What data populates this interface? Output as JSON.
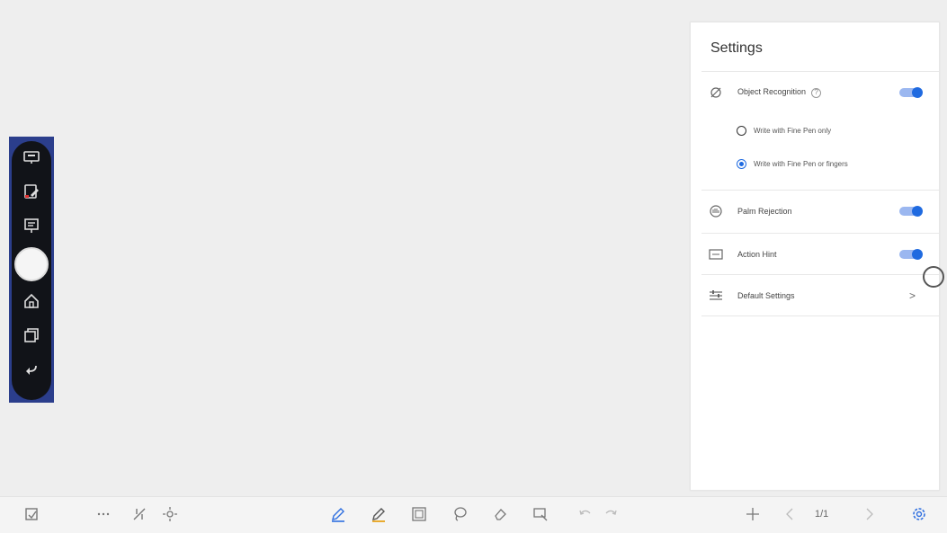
{
  "settings": {
    "title": "Settings",
    "object_recognition": {
      "label": "Object Recognition",
      "enabled": true
    },
    "radio_options": [
      {
        "label": "Write with Fine Pen only",
        "selected": false
      },
      {
        "label": "Write with Fine Pen or fingers",
        "selected": true
      }
    ],
    "palm_rejection": {
      "label": "Palm Rejection",
      "enabled": true
    },
    "action_hint": {
      "label": "Action Hint",
      "enabled": true
    },
    "default_settings": {
      "label": "Default Settings",
      "chevron": ">"
    }
  },
  "bottom_bar": {
    "page_indicator": "1/1"
  },
  "icons": {
    "side": [
      "screen-icon",
      "annotate-icon",
      "whiteboard-icon",
      "home-icon",
      "windows-icon",
      "back-icon"
    ],
    "bottom": [
      "save-icon",
      "more-icon",
      "tools-icon",
      "move-icon",
      "pen-icon",
      "highlighter-icon",
      "image-icon",
      "lasso-icon",
      "eraser-icon",
      "shape-icon",
      "undo-icon",
      "redo-icon",
      "add-page-icon",
      "prev-page-icon",
      "next-page-icon",
      "settings-icon"
    ]
  },
  "colors": {
    "accent": "#1f6ae0",
    "toggle_track": "#9bb7f0",
    "pen_active": "#e8a31a"
  }
}
